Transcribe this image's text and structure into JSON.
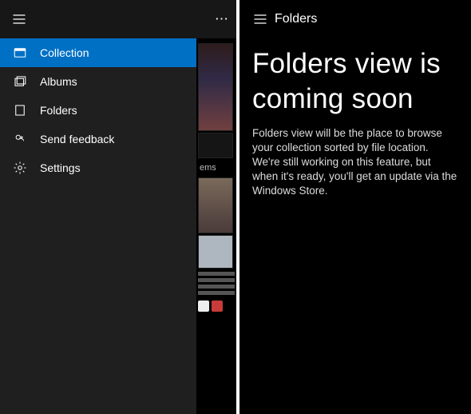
{
  "left": {
    "sidebar": {
      "items": [
        {
          "label": "Collection",
          "icon": "collection-icon",
          "active": true
        },
        {
          "label": "Albums",
          "icon": "albums-icon",
          "active": false
        },
        {
          "label": "Folders",
          "icon": "folders-icon",
          "active": false
        },
        {
          "label": "Send feedback",
          "icon": "feedback-icon",
          "active": false
        },
        {
          "label": "Settings",
          "icon": "settings-icon",
          "active": false
        }
      ]
    },
    "peek_label": "ems"
  },
  "right": {
    "header_title": "Folders",
    "headline": "Folders view is coming soon",
    "body": "Folders view will be the place to browse your collection sorted by file location. We're still working on this feature, but when it's ready, you'll get an update via the Windows Store."
  }
}
